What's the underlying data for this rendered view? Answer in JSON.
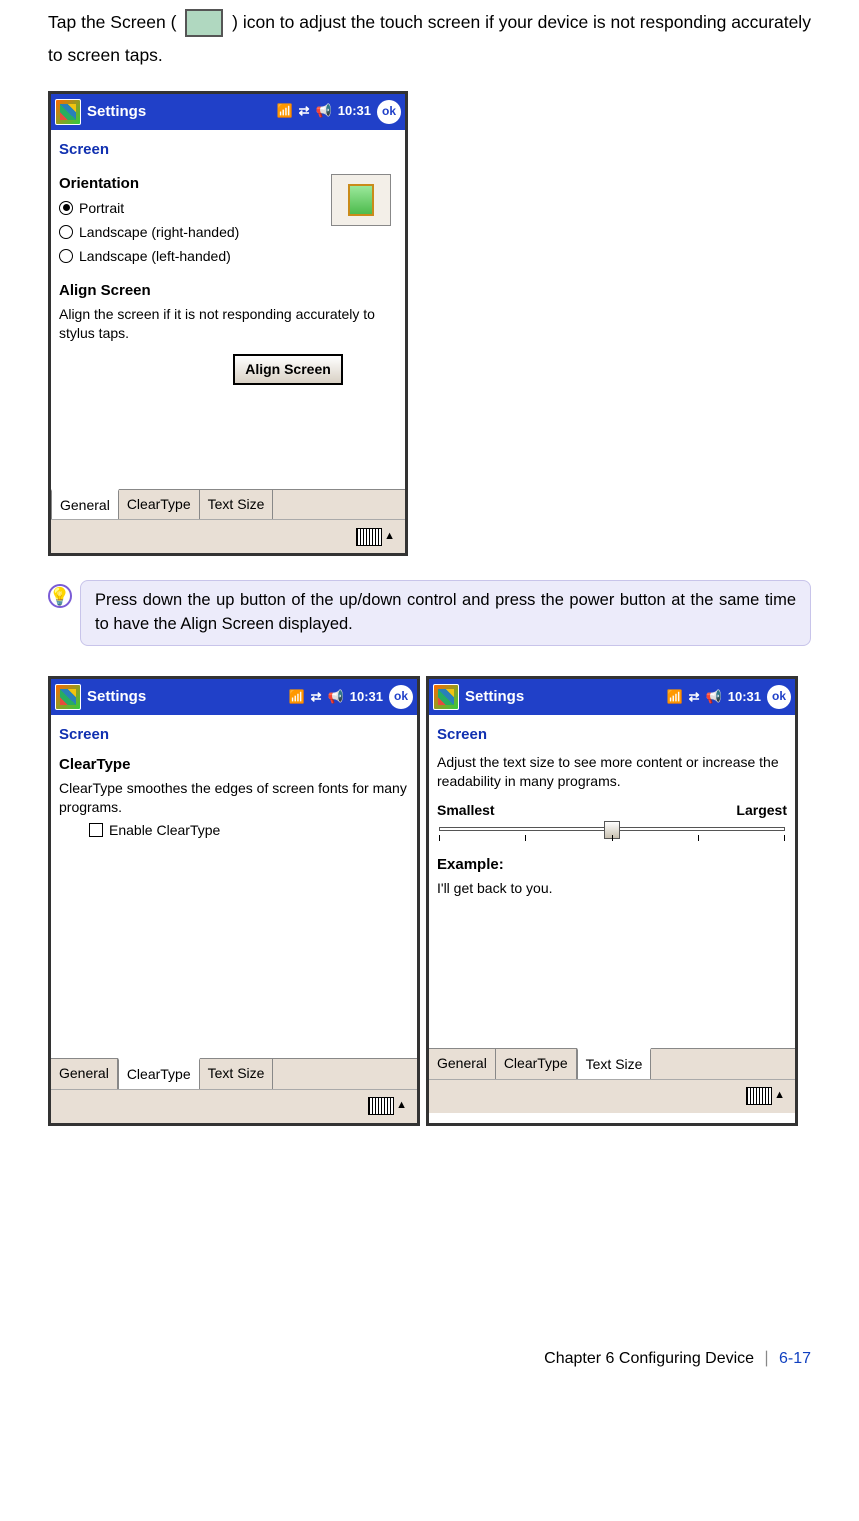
{
  "intro": {
    "pre": "Tap the Screen (",
    "post": ") icon to adjust the touch screen if your device is not responding accurately to screen taps."
  },
  "pda_common": {
    "title": "Settings",
    "time": "10:31",
    "ok": "ok",
    "screen_label": "Screen",
    "tabs": {
      "general": "General",
      "cleartype": "ClearType",
      "textsize": "Text Size"
    }
  },
  "pda1": {
    "orientation_heading": "Orientation",
    "opt_portrait": "Portrait",
    "opt_land_right": "Landscape (right-handed)",
    "opt_land_left": "Landscape (left-handed)",
    "align_heading": "Align Screen",
    "align_desc": "Align the screen if it is not responding accurately to stylus taps.",
    "align_button": "Align Screen"
  },
  "tip": "Press down the up button of the up/down control and press the power button at the same time to have the Align Screen displayed.",
  "pda2": {
    "ct_heading": "ClearType",
    "ct_desc": "ClearType smoothes the edges of screen fonts for many programs.",
    "ct_checkbox": "Enable ClearType"
  },
  "pda3": {
    "ts_desc": "Adjust the text size to see more content or increase the readability in many programs.",
    "smallest": "Smallest",
    "largest": "Largest",
    "example_heading": "Example:",
    "example_text": "I'll get back to you."
  },
  "footer": {
    "chapter": "Chapter 6 Configuring Device",
    "page": "6-17"
  }
}
